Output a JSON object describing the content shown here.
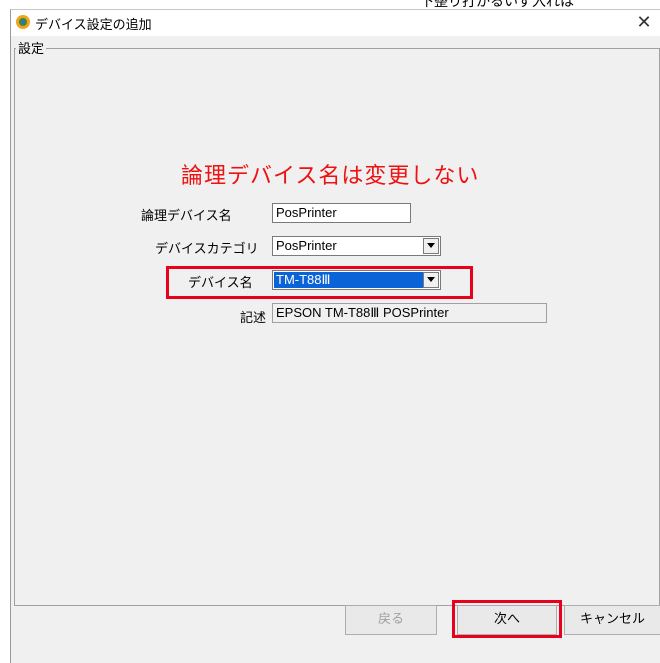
{
  "window": {
    "title": "デバイス設定の追加",
    "top_cut_text": "下整り打かるいず入れは"
  },
  "group": {
    "label": "設定"
  },
  "heading": "論理デバイス名は変更しない",
  "form": {
    "logical_device_name": {
      "label": "論理デバイス名",
      "value": "PosPrinter"
    },
    "device_category": {
      "label": "デバイスカテゴリ",
      "value": "PosPrinter"
    },
    "device_name": {
      "label": "デバイス名",
      "value": "TM-T88Ⅲ"
    },
    "description": {
      "label": "記述",
      "value": "EPSON TM-T88Ⅲ POSPrinter"
    }
  },
  "buttons": {
    "back": "戻る",
    "next": "次へ",
    "cancel": "キャンセル"
  },
  "colors": {
    "heading": "#ee1111",
    "highlight": "#e8001c",
    "selection": "#0a64d8"
  }
}
